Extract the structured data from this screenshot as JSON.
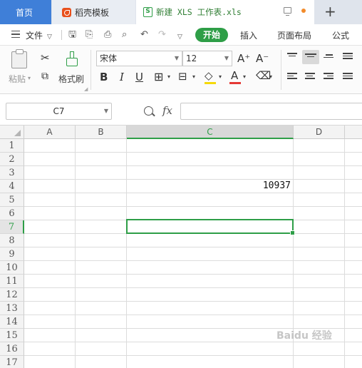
{
  "tabs": [
    {
      "label": "首页"
    },
    {
      "label": "稻壳模板"
    },
    {
      "label": "新建 XLS 工作表.xls"
    }
  ],
  "menu": {
    "file": "文件",
    "start": "开始",
    "insert": "插入",
    "page_layout": "页面布局",
    "formula": "公式"
  },
  "ribbon": {
    "paste": "粘贴",
    "format_painter": "格式刷",
    "font_name": "宋体",
    "font_size": "12",
    "bold": "B",
    "italic": "I",
    "underline": "U",
    "font_grow": "A⁺",
    "font_shrink": "A⁻",
    "font_color_letter": "A",
    "font_color": "#e53935",
    "fill_color": "#f5d90a"
  },
  "formula_bar": {
    "name_box": "C7",
    "fx": "fx",
    "value": ""
  },
  "sheet": {
    "columns": [
      "A",
      "B",
      "C",
      "D"
    ],
    "rows": [
      "1",
      "2",
      "3",
      "4",
      "5",
      "6",
      "7",
      "8",
      "9",
      "10",
      "11",
      "12",
      "13",
      "14",
      "15",
      "16",
      "17"
    ],
    "active_cell": "C7",
    "cells": {
      "C4": "10937"
    }
  },
  "colors": {
    "accent": "#2e9e47",
    "home_tab": "#3f7fd8"
  },
  "watermark": "Baidu 经验"
}
